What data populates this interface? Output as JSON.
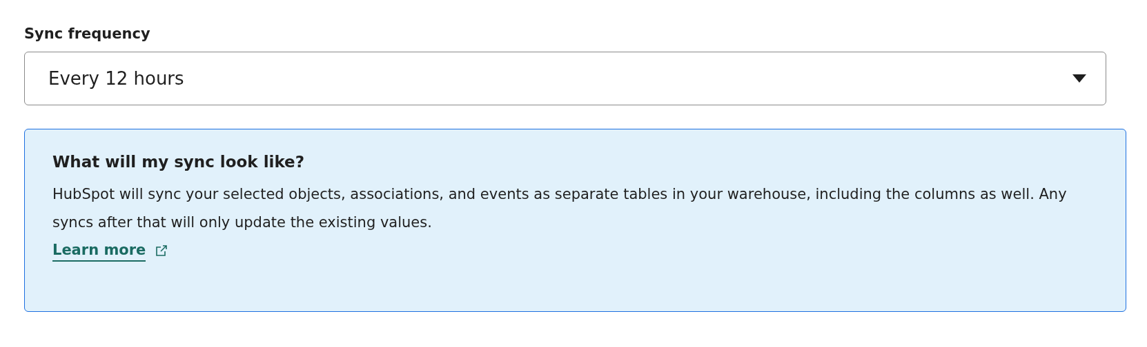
{
  "field": {
    "label": "Sync frequency",
    "value": "Every 12 hours"
  },
  "info": {
    "title": "What will my sync look like?",
    "body": "HubSpot will sync your selected objects, associations, and events as separate tables in your warehouse, including the columns as well. Any syncs after that will only update the existing values.",
    "link": "Learn more"
  }
}
